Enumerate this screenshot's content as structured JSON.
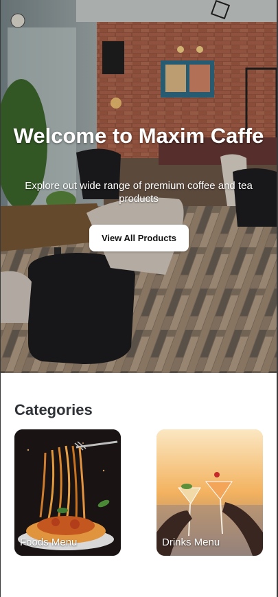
{
  "hero": {
    "title": "Welcome to Maxim Caffe",
    "subtitle": "Explore out wide range of premium coffee and tea products",
    "cta_label": "View All Products"
  },
  "categories": {
    "heading": "Categories",
    "items": [
      {
        "label": "Foods Menu",
        "image": "pasta-photo"
      },
      {
        "label": "Drinks Menu",
        "image": "cocktails-photo"
      }
    ]
  },
  "colors": {
    "heading": "#2f3337",
    "button_bg": "#ffffff",
    "button_text": "#111111"
  }
}
